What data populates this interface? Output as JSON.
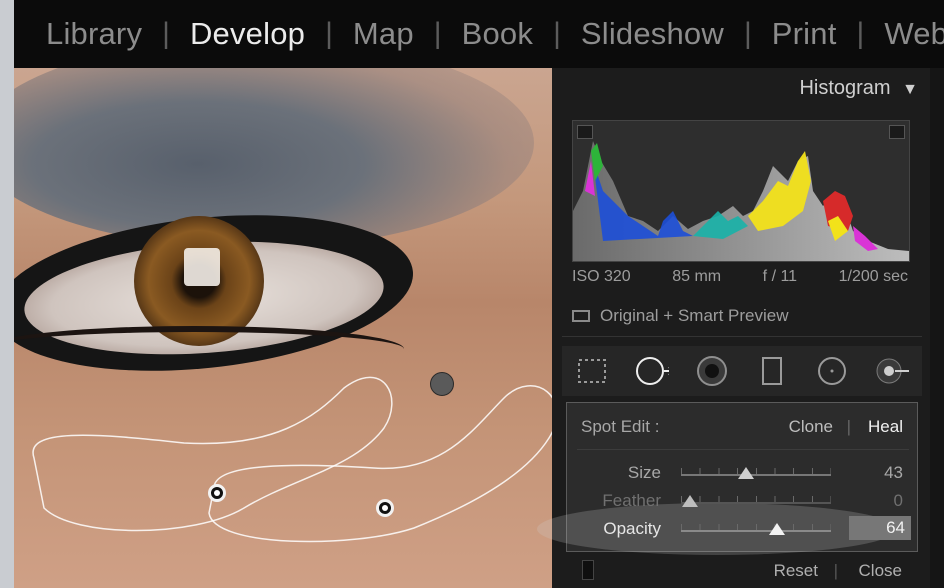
{
  "modules": [
    {
      "label": "Library",
      "active": false
    },
    {
      "label": "Develop",
      "active": true
    },
    {
      "label": "Map",
      "active": false
    },
    {
      "label": "Book",
      "active": false
    },
    {
      "label": "Slideshow",
      "active": false
    },
    {
      "label": "Print",
      "active": false
    },
    {
      "label": "Web",
      "active": false
    }
  ],
  "histogram": {
    "title": "Histogram",
    "collapse_icon": "triangle-down-icon",
    "iso": "ISO 320",
    "focal_length": "85 mm",
    "aperture": "f / 11",
    "shutter": "1/200 sec",
    "preview_label": "Original + Smart Preview"
  },
  "tools": [
    "crop-overlay-icon",
    "spot-removal-icon",
    "red-eye-icon",
    "graduated-filter-icon",
    "radial-filter-icon",
    "adjustment-brush-icon"
  ],
  "spot_edit": {
    "label": "Spot Edit :",
    "clone": "Clone",
    "heal": "Heal",
    "size_label": "Size",
    "size_value": "43",
    "size_fraction": 0.43,
    "feather_label": "Feather",
    "feather_value": "0",
    "feather_fraction": 0.06,
    "opacity_label": "Opacity",
    "opacity_value": "64",
    "opacity_fraction": 0.64
  },
  "footer": {
    "reset": "Reset",
    "close": "Close"
  },
  "colors": {
    "accent": "#ececec",
    "panel": "#1c1c1c",
    "highlight": "#777777"
  }
}
